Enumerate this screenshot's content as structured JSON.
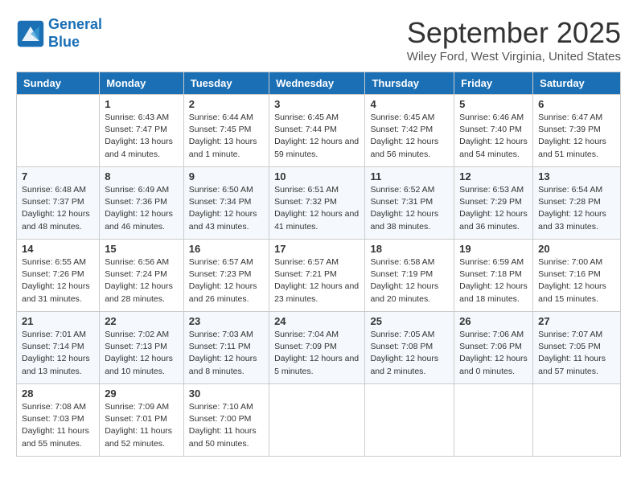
{
  "app": {
    "logo_line1": "General",
    "logo_line2": "Blue"
  },
  "title": "September 2025",
  "location": "Wiley Ford, West Virginia, United States",
  "day_headers": [
    "Sunday",
    "Monday",
    "Tuesday",
    "Wednesday",
    "Thursday",
    "Friday",
    "Saturday"
  ],
  "weeks": [
    [
      {
        "day": "",
        "empty": true
      },
      {
        "day": "1",
        "sunrise": "6:43 AM",
        "sunset": "7:47 PM",
        "daylight": "13 hours and 4 minutes."
      },
      {
        "day": "2",
        "sunrise": "6:44 AM",
        "sunset": "7:45 PM",
        "daylight": "13 hours and 1 minute."
      },
      {
        "day": "3",
        "sunrise": "6:45 AM",
        "sunset": "7:44 PM",
        "daylight": "12 hours and 59 minutes."
      },
      {
        "day": "4",
        "sunrise": "6:45 AM",
        "sunset": "7:42 PM",
        "daylight": "12 hours and 56 minutes."
      },
      {
        "day": "5",
        "sunrise": "6:46 AM",
        "sunset": "7:40 PM",
        "daylight": "12 hours and 54 minutes."
      },
      {
        "day": "6",
        "sunrise": "6:47 AM",
        "sunset": "7:39 PM",
        "daylight": "12 hours and 51 minutes."
      }
    ],
    [
      {
        "day": "7",
        "sunrise": "6:48 AM",
        "sunset": "7:37 PM",
        "daylight": "12 hours and 48 minutes."
      },
      {
        "day": "8",
        "sunrise": "6:49 AM",
        "sunset": "7:36 PM",
        "daylight": "12 hours and 46 minutes."
      },
      {
        "day": "9",
        "sunrise": "6:50 AM",
        "sunset": "7:34 PM",
        "daylight": "12 hours and 43 minutes."
      },
      {
        "day": "10",
        "sunrise": "6:51 AM",
        "sunset": "7:32 PM",
        "daylight": "12 hours and 41 minutes."
      },
      {
        "day": "11",
        "sunrise": "6:52 AM",
        "sunset": "7:31 PM",
        "daylight": "12 hours and 38 minutes."
      },
      {
        "day": "12",
        "sunrise": "6:53 AM",
        "sunset": "7:29 PM",
        "daylight": "12 hours and 36 minutes."
      },
      {
        "day": "13",
        "sunrise": "6:54 AM",
        "sunset": "7:28 PM",
        "daylight": "12 hours and 33 minutes."
      }
    ],
    [
      {
        "day": "14",
        "sunrise": "6:55 AM",
        "sunset": "7:26 PM",
        "daylight": "12 hours and 31 minutes."
      },
      {
        "day": "15",
        "sunrise": "6:56 AM",
        "sunset": "7:24 PM",
        "daylight": "12 hours and 28 minutes."
      },
      {
        "day": "16",
        "sunrise": "6:57 AM",
        "sunset": "7:23 PM",
        "daylight": "12 hours and 26 minutes."
      },
      {
        "day": "17",
        "sunrise": "6:57 AM",
        "sunset": "7:21 PM",
        "daylight": "12 hours and 23 minutes."
      },
      {
        "day": "18",
        "sunrise": "6:58 AM",
        "sunset": "7:19 PM",
        "daylight": "12 hours and 20 minutes."
      },
      {
        "day": "19",
        "sunrise": "6:59 AM",
        "sunset": "7:18 PM",
        "daylight": "12 hours and 18 minutes."
      },
      {
        "day": "20",
        "sunrise": "7:00 AM",
        "sunset": "7:16 PM",
        "daylight": "12 hours and 15 minutes."
      }
    ],
    [
      {
        "day": "21",
        "sunrise": "7:01 AM",
        "sunset": "7:14 PM",
        "daylight": "12 hours and 13 minutes."
      },
      {
        "day": "22",
        "sunrise": "7:02 AM",
        "sunset": "7:13 PM",
        "daylight": "12 hours and 10 minutes."
      },
      {
        "day": "23",
        "sunrise": "7:03 AM",
        "sunset": "7:11 PM",
        "daylight": "12 hours and 8 minutes."
      },
      {
        "day": "24",
        "sunrise": "7:04 AM",
        "sunset": "7:09 PM",
        "daylight": "12 hours and 5 minutes."
      },
      {
        "day": "25",
        "sunrise": "7:05 AM",
        "sunset": "7:08 PM",
        "daylight": "12 hours and 2 minutes."
      },
      {
        "day": "26",
        "sunrise": "7:06 AM",
        "sunset": "7:06 PM",
        "daylight": "12 hours and 0 minutes."
      },
      {
        "day": "27",
        "sunrise": "7:07 AM",
        "sunset": "7:05 PM",
        "daylight": "11 hours and 57 minutes."
      }
    ],
    [
      {
        "day": "28",
        "sunrise": "7:08 AM",
        "sunset": "7:03 PM",
        "daylight": "11 hours and 55 minutes."
      },
      {
        "day": "29",
        "sunrise": "7:09 AM",
        "sunset": "7:01 PM",
        "daylight": "11 hours and 52 minutes."
      },
      {
        "day": "30",
        "sunrise": "7:10 AM",
        "sunset": "7:00 PM",
        "daylight": "11 hours and 50 minutes."
      },
      {
        "day": "",
        "empty": true
      },
      {
        "day": "",
        "empty": true
      },
      {
        "day": "",
        "empty": true
      },
      {
        "day": "",
        "empty": true
      }
    ]
  ]
}
